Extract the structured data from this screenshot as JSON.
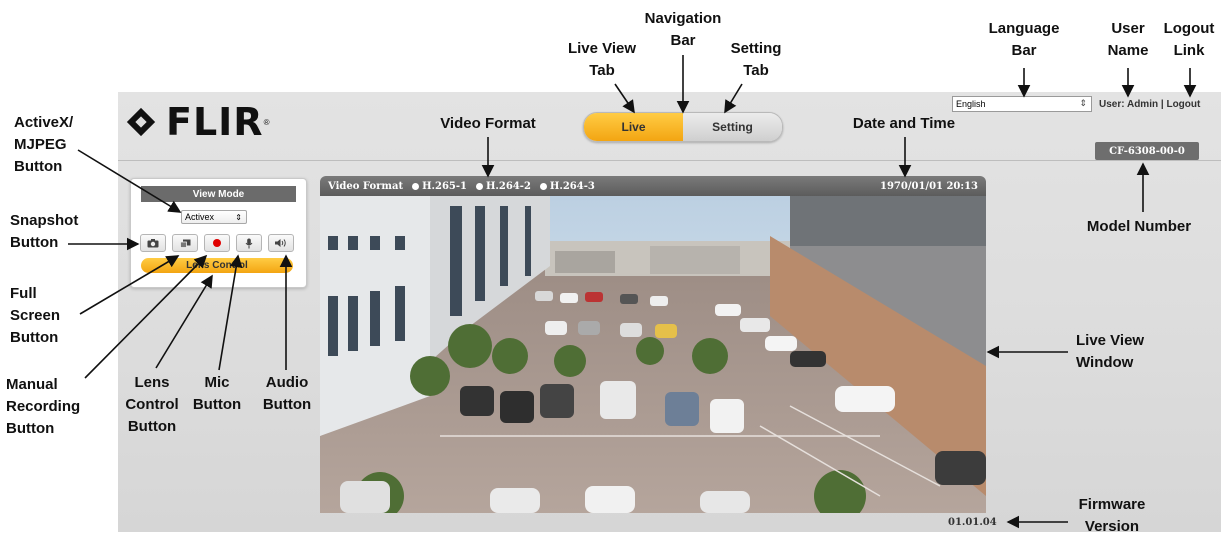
{
  "ui": {
    "logo_text": "FLIR",
    "nav": {
      "live_label": "Live",
      "setting_label": "Setting"
    },
    "language": {
      "selected": "English"
    },
    "user_bar": {
      "user_text": "User: Admin",
      "separator": "|",
      "logout_label": "Logout"
    },
    "model_number": "CF-6308-00-0",
    "view_mode": {
      "title": "View Mode",
      "player_select": "Activex",
      "buttons": [
        "camera-icon",
        "fullscreen-icon",
        "record-icon",
        "mic-icon",
        "speaker-icon"
      ],
      "lens_control_label": "Lens Control"
    },
    "video": {
      "format_label": "Video Format",
      "streams": [
        "H.265-1",
        "H.264-2",
        "H.264-3"
      ],
      "datetime": "1970/01/01 20:13"
    },
    "firmware_version": "01.01.04"
  },
  "annotations": {
    "navigation_bar": "Navigation\nBar",
    "live_view_tab": "Live View\nTab",
    "setting_tab": "Setting\nTab",
    "language_bar": "Language\nBar",
    "user_name": "User\nName",
    "logout_link": "Logout\nLink",
    "activex_button": "ActiveX/\nMJPEG\nButton",
    "video_format": "Video Format",
    "date_and_time": "Date and Time",
    "snapshot_button": "Snapshot\nButton",
    "model_number": "Model Number",
    "full_screen_button": "Full\nScreen\nButton",
    "live_view_window": "Live View\nWindow",
    "manual_recording_button": "Manual\nRecording\nButton",
    "lens_control_button": "Lens\nControl\nButton",
    "mic_button": "Mic\nButton",
    "audio_button": "Audio\nButton",
    "firmware_version": "Firmware\nVersion"
  },
  "colors": {
    "accent": "#f3a512",
    "bar": "#6b6b6b",
    "background": "#dedede"
  }
}
